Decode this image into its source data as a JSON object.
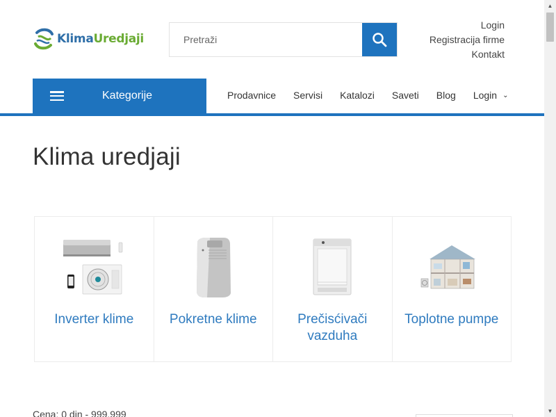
{
  "header": {
    "logo": {
      "part1": "Klima",
      "part2": "Uredjaji"
    },
    "search": {
      "placeholder": "Pretraži"
    },
    "top_links": [
      "Login",
      "Registracija firme",
      "Kontakt"
    ]
  },
  "nav": {
    "categories_label": "Kategorije",
    "items": [
      "Prodavnice",
      "Servisi",
      "Katalozi",
      "Saveti",
      "Blog",
      "Login"
    ]
  },
  "main": {
    "title": "Klima uredjaji",
    "categories": [
      {
        "label": "Inverter klime",
        "icon": "inverter-ac-image"
      },
      {
        "label": "Pokretne klime",
        "icon": "portable-ac-image"
      },
      {
        "label": "Prečisćivači vazduha",
        "icon": "air-purifier-image"
      },
      {
        "label": "Toplotne pumpe",
        "icon": "heat-pump-house-image"
      }
    ],
    "price_filter": "Cena: 0 din - 999.999"
  },
  "colors": {
    "accent": "#1e73be",
    "link": "#2f7bbf",
    "logo_blue": "#2f6fa8",
    "logo_green": "#6aab33"
  }
}
